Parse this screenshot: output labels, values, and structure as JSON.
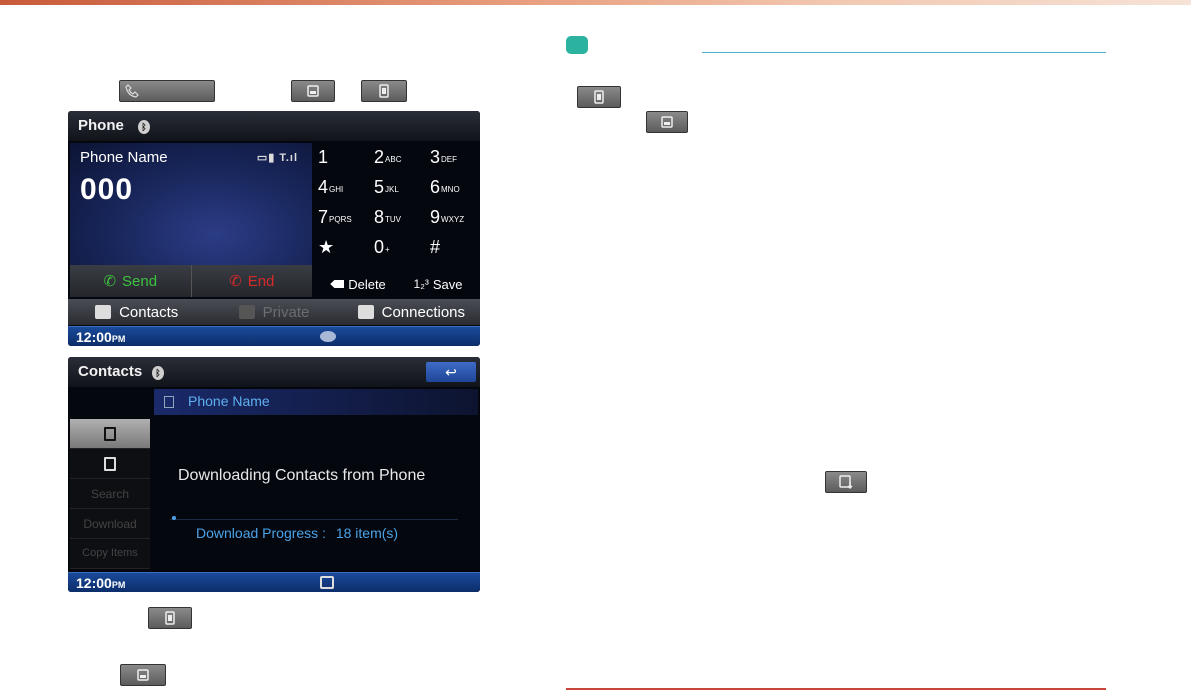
{
  "phone_screen": {
    "title": "Phone",
    "phone_name": "Phone Name",
    "signal_label": "▭▮ T.ıl",
    "dialed_number": "000",
    "send_label": "Send",
    "end_label": "End",
    "keypad": [
      {
        "digit": "1",
        "letters": ""
      },
      {
        "digit": "2",
        "letters": "ABC"
      },
      {
        "digit": "3",
        "letters": "DEF"
      },
      {
        "digit": "4",
        "letters": "GHI"
      },
      {
        "digit": "5",
        "letters": "JKL"
      },
      {
        "digit": "6",
        "letters": "MNO"
      },
      {
        "digit": "7",
        "letters": "PQRS"
      },
      {
        "digit": "8",
        "letters": "TUV"
      },
      {
        "digit": "9",
        "letters": "WXYZ"
      },
      {
        "digit": "★",
        "letters": ""
      },
      {
        "digit": "0",
        "letters": "+"
      },
      {
        "digit": "#",
        "letters": ""
      }
    ],
    "delete_label": "Delete",
    "save_label": "Save",
    "menu": {
      "contacts": "Contacts",
      "private": "Private",
      "connections": "Connections"
    },
    "clock": "12:00",
    "clock_suffix": "PM"
  },
  "contacts_screen": {
    "title": "Contacts",
    "back_icon": "↩",
    "list_title": "Phone Name",
    "side_items": {
      "search": "Search",
      "download": "Download",
      "copy_items": "Copy Items"
    },
    "download_message": "Downloading Contacts from Phone",
    "progress_label": "Download Progress :",
    "progress_count": "18 item(s)",
    "clock": "12:00",
    "clock_suffix": "PM"
  },
  "colors": {
    "accent_teal": "#2bb3a0",
    "rule_red": "#c8463a",
    "send_green": "#3cc23c",
    "end_red": "#d52a2a",
    "progress_blue": "#4aa3e8"
  }
}
